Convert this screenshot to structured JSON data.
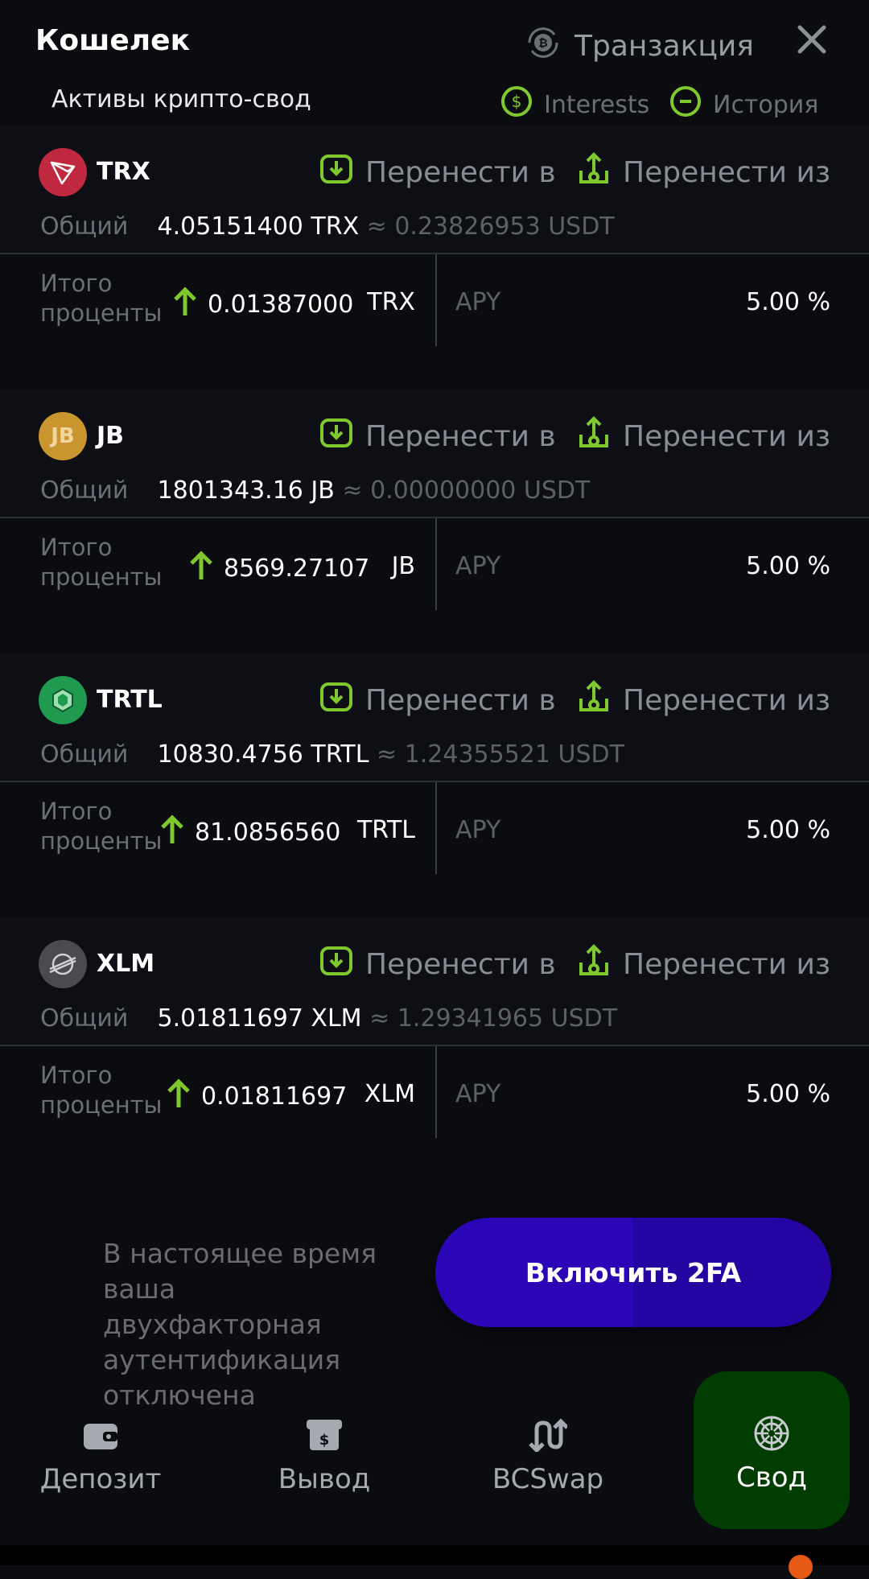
{
  "header": {
    "title": "Кошелек",
    "transaction_label": "Транзакция"
  },
  "subheader": {
    "title": "Активы крипто-свод",
    "interests_label": "Interests",
    "history_label": "История"
  },
  "transfer_in_label": "Перенести в",
  "transfer_out_label": "Перенести из",
  "total_label": "Общий",
  "interest_label": "Итого проценты",
  "apy_label": "APY",
  "assets": [
    {
      "name": "TRX",
      "color": "#c0283f",
      "total": "4.05151400 TRX",
      "usdt": "≈ 0.23826953 USDT",
      "interest": "0.01387000",
      "unit": "TRX",
      "apy": "5.00 %"
    },
    {
      "name": "JB",
      "color": "#c9952e",
      "total": "1801343.16 JB",
      "usdt": "≈ 0.00000000 USDT",
      "interest": "8569.27107",
      "unit": "JB",
      "apy": "5.00 %"
    },
    {
      "name": "TRTL",
      "color": "#1f9a4f",
      "total": "10830.4756 TRTL",
      "usdt": "≈ 1.24355521 USDT",
      "interest": "81.0856560",
      "unit": "TRTL",
      "apy": "5.00 %"
    },
    {
      "name": "XLM",
      "color": "#4a4b50",
      "total": "5.01811697 XLM",
      "usdt": "≈ 1.29341965 USDT",
      "interest": "0.01811697",
      "unit": "XLM",
      "apy": "5.00 %"
    }
  ],
  "twofa": {
    "text": "В настоящее время ваша двухфакторная аутентификация отключена",
    "button": "Включить 2FA"
  },
  "nav": {
    "deposit": "Депозит",
    "withdraw": "Вывод",
    "swap": "BCSwap",
    "vault": "Свод"
  },
  "colors": {
    "accent_green": "#7fc92f",
    "button_purple": "#2b06b6",
    "active_nav": "#013c00"
  }
}
